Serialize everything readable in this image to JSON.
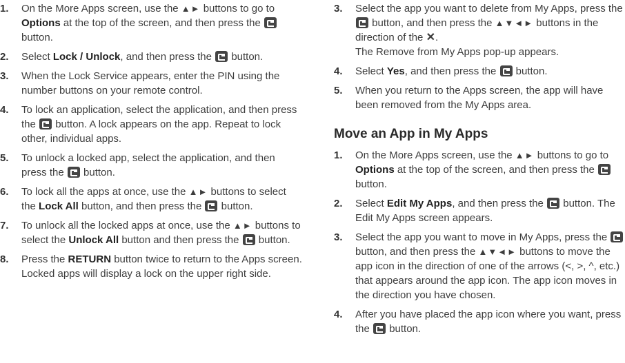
{
  "left_steps": [
    {
      "num": "1.",
      "parts": [
        {
          "t": "On the More Apps screen, use the "
        },
        {
          "a": "lr"
        },
        {
          "t": " buttons to go to "
        },
        {
          "b": "Options"
        },
        {
          "t": " at the top of the screen, and then press the "
        },
        {
          "e": 1
        },
        {
          "t": " button."
        }
      ]
    },
    {
      "num": "2.",
      "parts": [
        {
          "t": "Select "
        },
        {
          "b": "Lock / Unlock"
        },
        {
          "t": ", and then press the "
        },
        {
          "e": 1
        },
        {
          "t": " button."
        }
      ]
    },
    {
      "num": "3.",
      "parts": [
        {
          "t": "When the Lock Service appears, enter the PIN using the number buttons on your remote control."
        }
      ]
    },
    {
      "num": "4.",
      "parts": [
        {
          "t": "To lock an application, select the application, and then press the "
        },
        {
          "e": 1
        },
        {
          "t": " button. A lock appears on the app. Repeat to lock other, individual apps."
        }
      ]
    },
    {
      "num": "5.",
      "parts": [
        {
          "t": "To unlock a locked app, select the application, and then press the "
        },
        {
          "e": 1
        },
        {
          "t": " button."
        }
      ]
    },
    {
      "num": "6.",
      "parts": [
        {
          "t": "To lock all the apps at once, use the "
        },
        {
          "a": "lr"
        },
        {
          "t": " buttons to select the "
        },
        {
          "b": "Lock All"
        },
        {
          "t": " button, and then press the "
        },
        {
          "e": 1
        },
        {
          "t": " button."
        }
      ]
    },
    {
      "num": "7.",
      "parts": [
        {
          "t": "To unlock all the locked apps at once, use the "
        },
        {
          "a": "lr"
        },
        {
          "t": " buttons to select the "
        },
        {
          "b": "Unlock All"
        },
        {
          "t": " button and then press the "
        },
        {
          "e": 1
        },
        {
          "t": " button."
        }
      ]
    },
    {
      "num": "8.",
      "parts": [
        {
          "t": "Press the "
        },
        {
          "b": "RETURN"
        },
        {
          "t": " button twice to return to the Apps screen. Locked apps will display a lock on the upper right side."
        }
      ]
    }
  ],
  "right_steps_top": [
    {
      "num": "3.",
      "parts": [
        {
          "t": "Select the app you want to delete from My Apps, press the "
        },
        {
          "e": 1
        },
        {
          "t": " button, and then press the "
        },
        {
          "a": "udlr"
        },
        {
          "t": " buttons in the direction of the "
        },
        {
          "x": 1
        },
        {
          "t": "."
        },
        {
          "br": 1
        },
        {
          "t": "The Remove from My Apps pop-up appears."
        }
      ]
    },
    {
      "num": "4.",
      "parts": [
        {
          "t": "Select "
        },
        {
          "b": "Yes"
        },
        {
          "t": ", and then press the "
        },
        {
          "e": 1
        },
        {
          "t": " button."
        }
      ]
    },
    {
      "num": "5.",
      "parts": [
        {
          "t": "When you return to the Apps screen, the app will have been removed from the My Apps area."
        }
      ]
    }
  ],
  "section_heading": "Move an App in My Apps",
  "right_steps_bottom": [
    {
      "num": "1.",
      "parts": [
        {
          "t": "On the More Apps screen, use the "
        },
        {
          "a": "lr"
        },
        {
          "t": " buttons to go to "
        },
        {
          "b": "Options"
        },
        {
          "t": " at the top of the screen, and then press the "
        },
        {
          "e": 1
        },
        {
          "t": " button."
        }
      ]
    },
    {
      "num": "2.",
      "parts": [
        {
          "t": "Select "
        },
        {
          "b": "Edit My Apps"
        },
        {
          "t": ", and then press the "
        },
        {
          "e": 1
        },
        {
          "t": " button. The Edit My Apps screen appears."
        }
      ]
    },
    {
      "num": "3.",
      "parts": [
        {
          "t": "Select the app you want to move in My Apps, press the "
        },
        {
          "e": 1
        },
        {
          "t": " button, and then press the "
        },
        {
          "a": "udlr"
        },
        {
          "t": " buttons to move the app icon in the direction of one of the arrows (<, >, ^, etc.) that appears around the app icon. The app icon moves in the direction you have chosen."
        }
      ]
    },
    {
      "num": "4.",
      "parts": [
        {
          "t": "After you have placed the app icon where you want, press the "
        },
        {
          "e": 1
        },
        {
          "t": " button."
        }
      ]
    }
  ],
  "icons": {
    "enter": "enter-button-icon",
    "lr": "left-right-arrows-icon",
    "udlr": "four-way-arrows-icon",
    "x": "x-mark-icon"
  }
}
